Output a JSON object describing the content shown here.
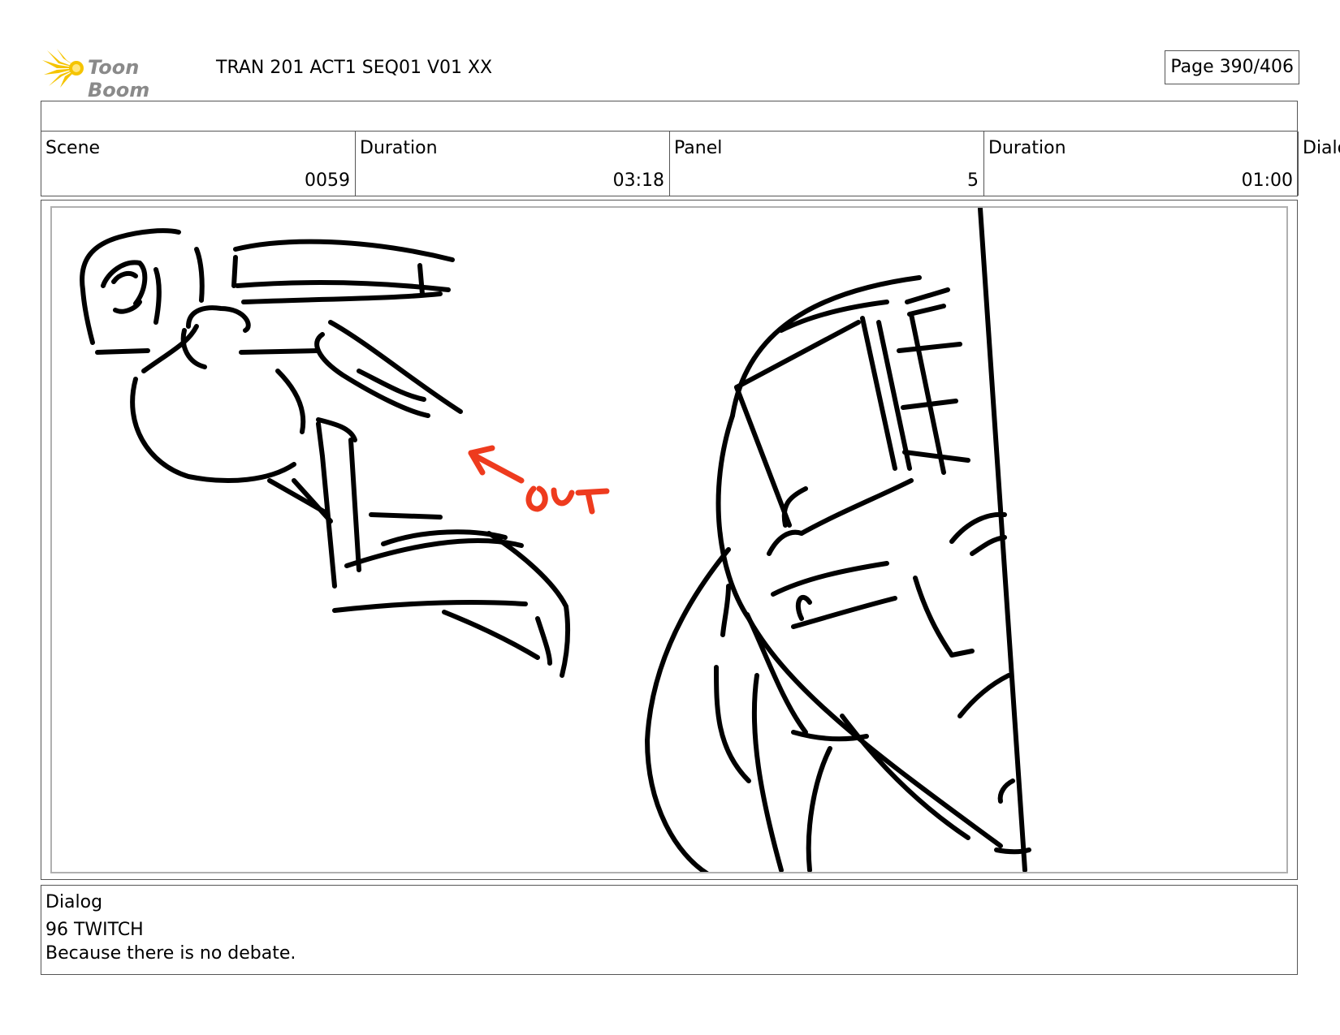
{
  "header": {
    "logo_text": "Toon Boom",
    "title": "TRAN 201 ACT1 SEQ01 V01 XX",
    "page": "Page 390/406"
  },
  "info": {
    "scene_label": "Scene",
    "scene_value": "0059",
    "duration_label": "Duration",
    "duration_value": "03:18",
    "panel_label": "Panel",
    "panel_value": "5",
    "panel_duration_label": "Duration",
    "panel_duration_value": "01:00",
    "overflow_label": "Dialo"
  },
  "panel": {
    "annotation": "OUT",
    "annotation_color": "#ee3b1e"
  },
  "dialog": {
    "label": "Dialog",
    "line1": "96 TWITCH",
    "line2": "Because there is no debate."
  },
  "colors": {
    "logo_star": "#f5c400",
    "logo_text": "#8a8a8a"
  }
}
